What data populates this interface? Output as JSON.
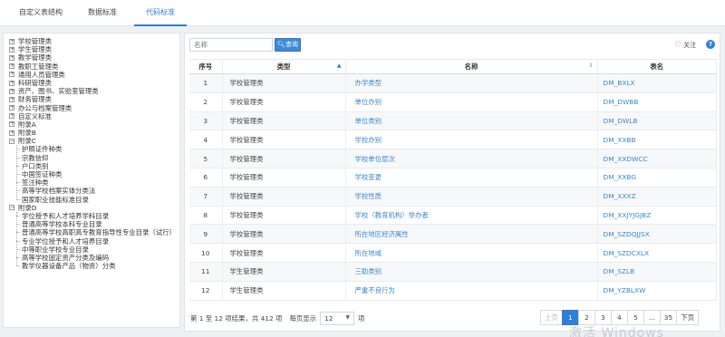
{
  "tabs": [
    "自定义表结构",
    "数据标准",
    "代码标准"
  ],
  "tree": {
    "top_items": [
      "学校管理类",
      "学生管理类",
      "教学管理类",
      "教职工管理类",
      "通用人员管理类",
      "科研管理类",
      "资产、图书、实验室管理类",
      "财务管理类",
      "办公与档案管理类",
      "自定义标准",
      "附录A",
      "附录B"
    ],
    "appendix_c": {
      "label": "附录C",
      "children": [
        "护照证件种类",
        "宗教信仰",
        "户口类别",
        "中国签证种类",
        "签注种类",
        "高等学校档案实体分类法",
        "国家职业技能标准目录"
      ]
    },
    "appendix_d": {
      "label": "附录D",
      "children": [
        "学位授予和人才培养学科目录",
        "普通高等学校本科专业目录",
        "普通高等学校高职高专教育指导性专业目录（试行）",
        "专业学位授予和人才培养目录",
        "中等职业学校专业目录",
        "高等学校固定资产分类及编码",
        "教学仪器设备产品（物资）分类"
      ]
    }
  },
  "search": {
    "placeholder": "名称",
    "button": "查询"
  },
  "follow_label": "关注",
  "help_label": "?",
  "table": {
    "headers": [
      "序号",
      "类型",
      "名称",
      "表名"
    ],
    "rows": [
      {
        "no": "1",
        "type": "学校管理类",
        "name": "办学类型",
        "table": "DM_BXLX"
      },
      {
        "no": "2",
        "type": "学校管理类",
        "name": "单位办别",
        "table": "DM_DWBB"
      },
      {
        "no": "3",
        "type": "学校管理类",
        "name": "单位类别",
        "table": "DM_DWLB"
      },
      {
        "no": "4",
        "type": "学校管理类",
        "name": "学校办别",
        "table": "DM_XXBB"
      },
      {
        "no": "5",
        "type": "学校管理类",
        "name": "学校单位层次",
        "table": "DM_XXDWCC"
      },
      {
        "no": "6",
        "type": "学校管理类",
        "name": "学校变更",
        "table": "DM_XXBG"
      },
      {
        "no": "7",
        "type": "学校管理类",
        "name": "学校性质",
        "table": "DM_XXXZ"
      },
      {
        "no": "8",
        "type": "学校管理类",
        "name": "学校（教育机构）举办者",
        "table": "DM_XXJYJGJBZ"
      },
      {
        "no": "9",
        "type": "学校管理类",
        "name": "所在地区经济属性",
        "table": "DM_SZDQJJSX"
      },
      {
        "no": "10",
        "type": "学校管理类",
        "name": "所在地域",
        "table": "DM_SZDCXLX"
      },
      {
        "no": "11",
        "type": "学生管理类",
        "name": "三助类别",
        "table": "DM_SZLB"
      },
      {
        "no": "12",
        "type": "学生管理类",
        "name": "严重不良行为",
        "table": "DM_YZBLXW"
      }
    ]
  },
  "footer": {
    "info": "第 1 至 12 项结果，共 412 项",
    "per_page_label": "每页显示",
    "per_page_value": "12",
    "unit": "项"
  },
  "pagination": {
    "prev": "上页",
    "pages": [
      "1",
      "2",
      "3",
      "4",
      "5",
      "...",
      "35"
    ],
    "next": "下页"
  },
  "watermark": "激活 Windows",
  "colors": {
    "accent": "#2f7ed8",
    "link": "#3a88cf",
    "heart": "#d9534f"
  }
}
